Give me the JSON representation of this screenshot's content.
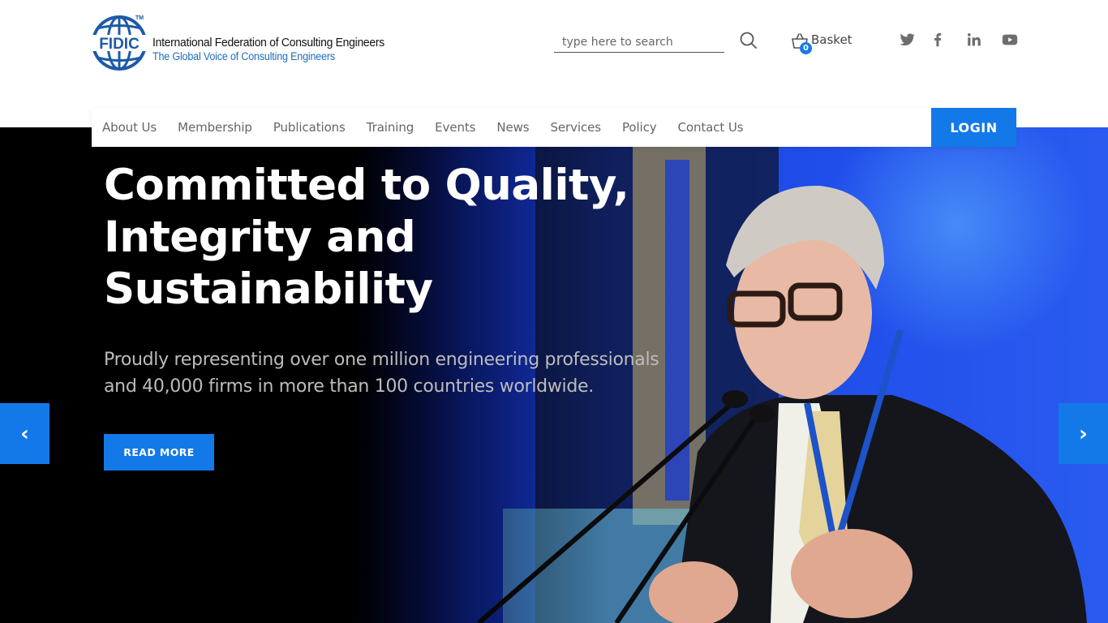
{
  "logo": {
    "acronym": "FIDIC",
    "trademark": "TM",
    "name": "International Federation of Consulting Engineers",
    "tagline": "The Global Voice of Consulting Engineers"
  },
  "search": {
    "placeholder": "type here to search",
    "value": ""
  },
  "basket": {
    "label": "Basket",
    "count": "0"
  },
  "social": [
    "twitter-icon",
    "facebook-icon",
    "linkedin-icon",
    "youtube-icon"
  ],
  "nav": {
    "items": [
      "About Us",
      "Membership",
      "Publications",
      "Training",
      "Events",
      "News",
      "Services",
      "Policy",
      "Contact Us"
    ],
    "login_label": "LOGIN"
  },
  "hero": {
    "title": "Committed to Quality, Integrity and Sustainability",
    "subtitle": "Proudly representing over one million engineering professionals and 40,000 firms in more than 100 countries worldwide.",
    "cta_label": "READ MORE",
    "prev_label": "‹",
    "next_label": "›"
  },
  "colors": {
    "accent": "#1479e8",
    "logo_blue": "#1d5aa8",
    "nav_text": "#666666"
  }
}
